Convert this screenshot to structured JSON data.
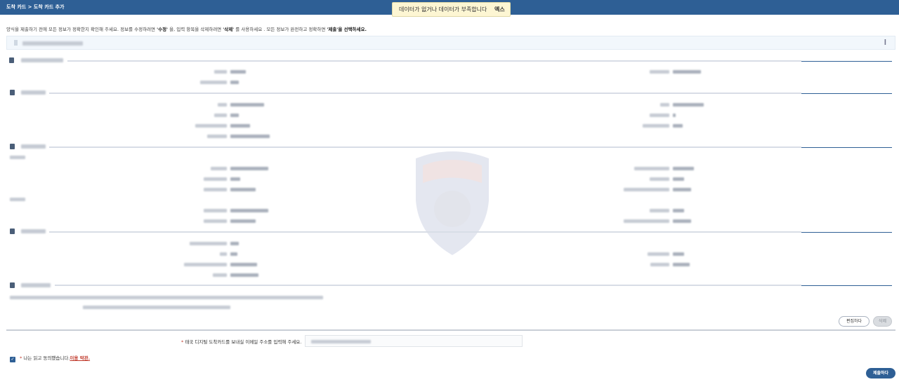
{
  "header": {
    "breadcrumb": "도착 카드 > 도착 카드 추가"
  },
  "toast": {
    "message": "데이터가 없거나 데이터가 부족합니다",
    "close_label": "엑스"
  },
  "instructions": {
    "part1": "양식을 제출하기 전에 모든 정보가 정확한지 확인해 주세요. 정보를 수정하려면 ",
    "edit_word": "'수정'",
    "part2": " 을, 입력 항목을 삭제하려면 ",
    "delete_word": "'삭제'",
    "part3": " 를 사용하세요 . 모든 정보가 완전하고 정확하면 ",
    "submit_word": "'제출'을 선택하세요."
  },
  "card": {
    "menu_icon": "kebab-icon"
  },
  "section_icons": [
    "plane-icon",
    "person-icon",
    "flag-icon",
    "doc-icon",
    "note-icon"
  ],
  "buttons": {
    "edit": "편집하다",
    "delete": "삭제",
    "submit": "제출하다"
  },
  "email": {
    "required_mark": "*",
    "label": "태국 디지털 도착카드를 보내실 이메일 주소를 입력해 주세요."
  },
  "agreement": {
    "required_mark": "*",
    "text": "나는 읽고 동의했습니다.",
    "link": "이용 약관."
  },
  "colors": {
    "brand": "#2e5f95",
    "toast_bg": "#fdf6d3",
    "required": "#c0392b"
  }
}
